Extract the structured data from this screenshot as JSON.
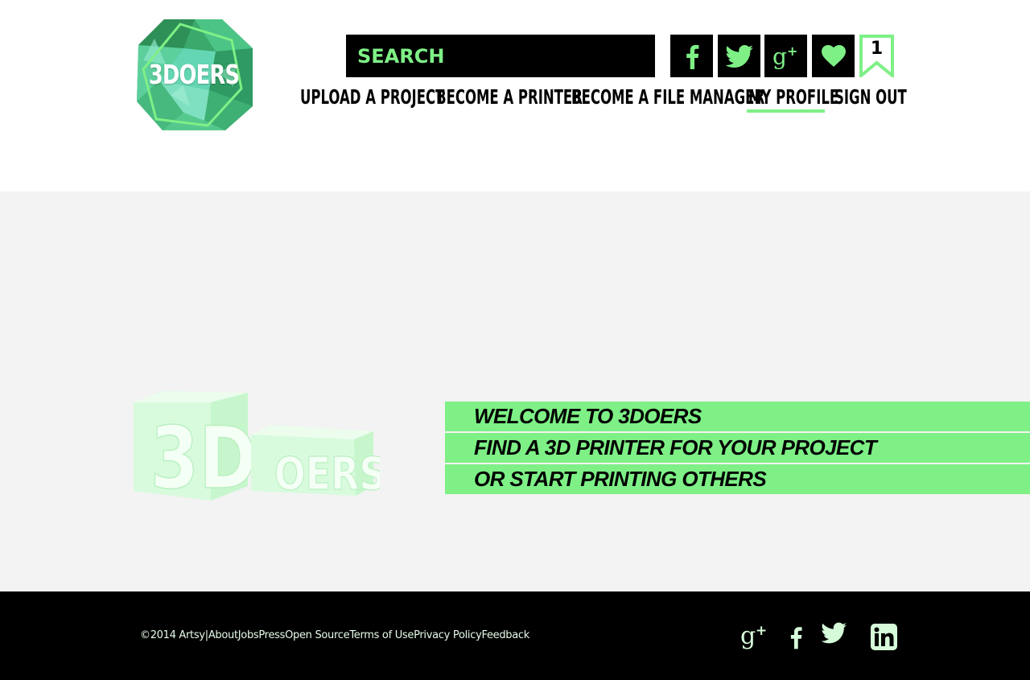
{
  "colors": {
    "accent": "#7ef086",
    "pale_accent": "#d6fbd9",
    "footer_bg": "#000000",
    "hero_bg": "#f3f3f3"
  },
  "brand": {
    "logo_text": "3DOERS"
  },
  "search": {
    "placeholder": "SEARCH"
  },
  "social_header": [
    {
      "icon": "facebook-icon"
    },
    {
      "icon": "twitter-icon"
    },
    {
      "icon": "google-plus-icon"
    },
    {
      "icon": "heart-icon"
    }
  ],
  "bookmark": {
    "count": "1"
  },
  "nav": {
    "upload": "UPLOAD A PROJECT",
    "printer": "BECOME A PRINTER",
    "file_manager": "BECOME A FILE MANAGER",
    "profile": "MY PROFILE",
    "signout": "SIGN OUT",
    "active": "MY PROFILE"
  },
  "hero": {
    "logo_big_text": "3D",
    "logo_small_text": "OERS",
    "lines": [
      "WELCOME TO 3DOERS",
      "FIND A 3D PRINTER FOR YOUR  PROJECT",
      "OR START PRINTING  OTHERS"
    ]
  },
  "footer": {
    "copyright": "©2014 Artsy",
    "separator": "|",
    "links": [
      "About",
      "Jobs",
      "Press",
      "Open Source",
      "Terms of Use",
      "Privacy Policy",
      "Feedback"
    ],
    "social": [
      {
        "icon": "google-plus-icon"
      },
      {
        "icon": "facebook-icon"
      },
      {
        "icon": "twitter-icon"
      },
      {
        "icon": "linkedin-icon"
      }
    ]
  }
}
